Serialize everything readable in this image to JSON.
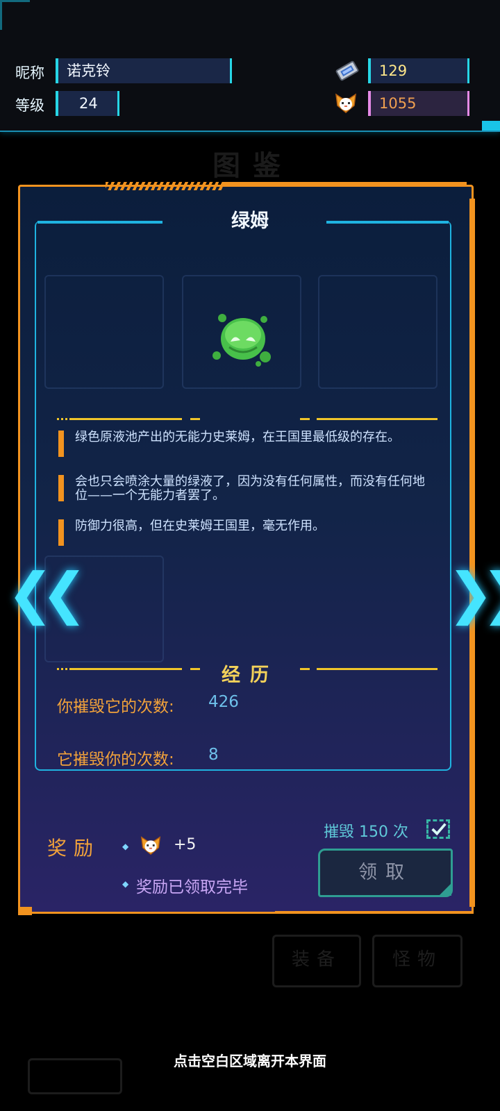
{
  "header": {
    "nickname_label": "昵称",
    "nickname_value": "诺克铃",
    "level_label": "等级",
    "level_value": "24",
    "tickets_icon": "ticket-icon",
    "tickets_value": "129",
    "coins_icon": "cat-coin-icon",
    "coins_value": "1055"
  },
  "background": {
    "page_title": "图鉴",
    "tab_equipment": "装备",
    "tab_monster": "怪物"
  },
  "monster": {
    "name": "绿姆",
    "sprite_icon": "green-slime-icon",
    "description": [
      "绿色原液池产出的无能力史莱姆，在王国里最低级的存在。",
      "会也只会喷涂大量的绿液了，因为没有任何属性，而没有任何地位——一个无能力者罢了。",
      "防御力很高，但在史莱姆王国里，毫无作用。"
    ]
  },
  "nav": {
    "prev_icon": "chevron-double-left-icon",
    "next_icon": "chevron-double-right-icon"
  },
  "experience": {
    "title": "经历",
    "killed_it_label": "你摧毁它的次数:",
    "killed_it_value": "426",
    "killed_you_label": "它摧毁你的次数:",
    "killed_you_value": "8"
  },
  "reward": {
    "label": "奖励",
    "amount": "+5",
    "status": "奖励已领取完毕",
    "goal": "摧毁 150 次",
    "goal_done": true,
    "claim_label": "领取"
  },
  "footer": {
    "leave_tip": "点击空白区域离开本界面"
  },
  "colors": {
    "panel_border": "#f2931f",
    "frame_cyan": "#1fb3e0",
    "accent_yellow": "#f0c52a",
    "stat_orange": "#f2a23a"
  }
}
